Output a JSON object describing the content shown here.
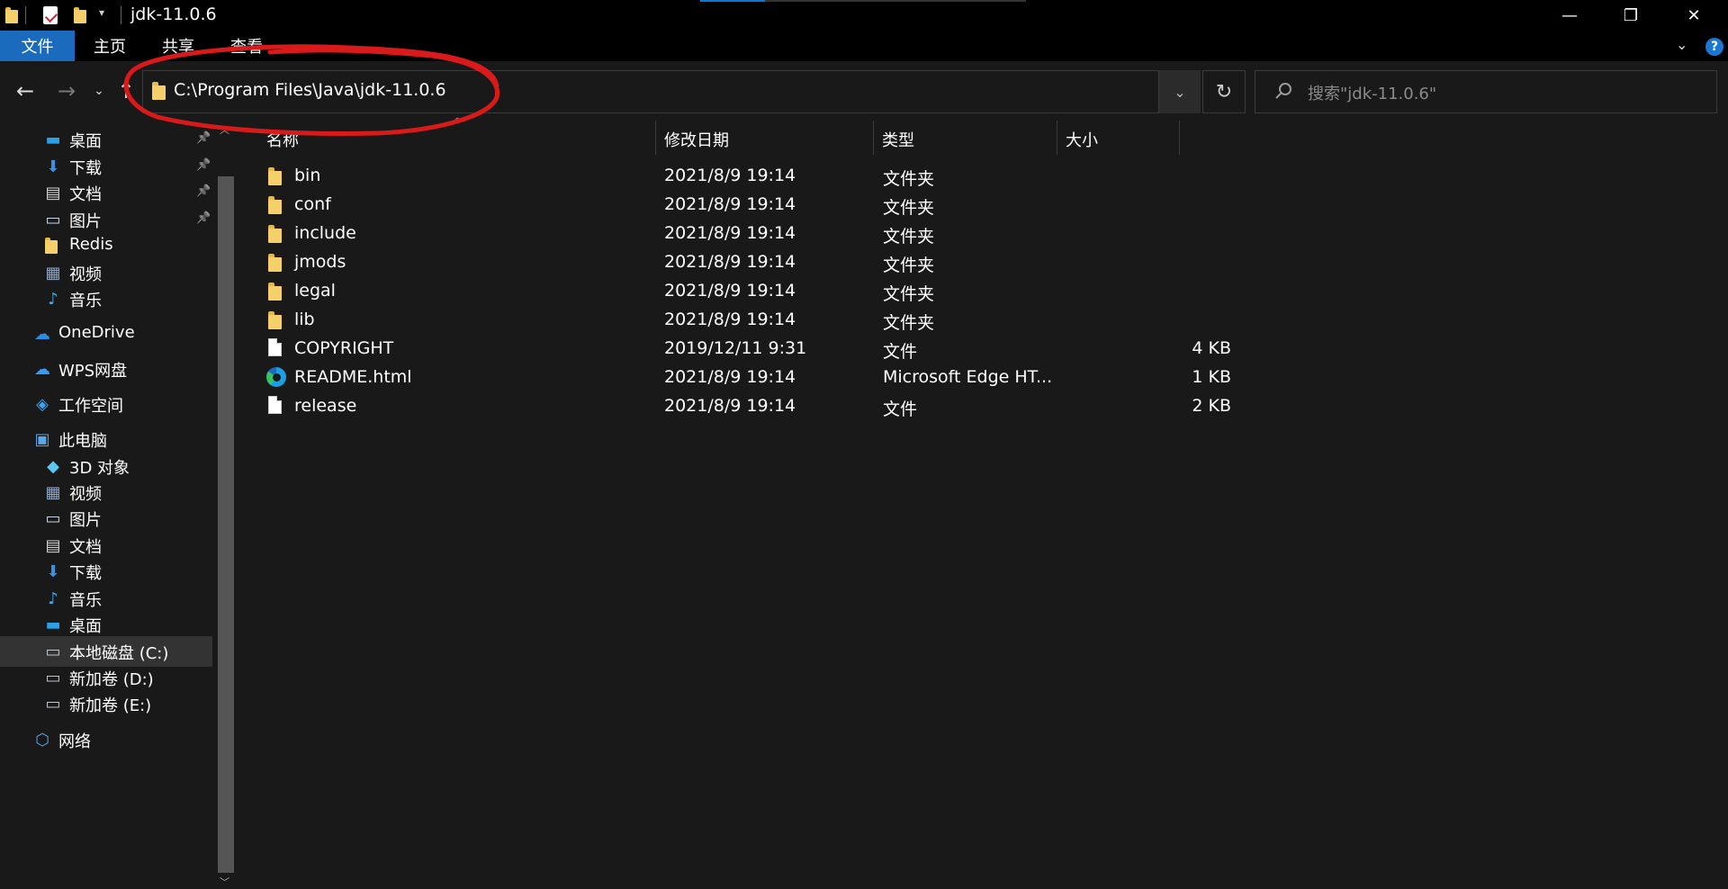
{
  "window": {
    "title": "jdk-11.0.6",
    "controls": {
      "minimize": "—",
      "maximize": "❐",
      "close": "✕"
    }
  },
  "ribbon": {
    "tabs": [
      "文件",
      "主页",
      "共享",
      "查看"
    ],
    "help": "?"
  },
  "address": {
    "path": "C:\\Program Files\\Java\\jdk-11.0.6"
  },
  "search": {
    "placeholder": "搜索\"jdk-11.0.6\""
  },
  "sidebar": {
    "items": [
      {
        "label": "桌面",
        "icon": "desktop-icon",
        "pinned": true
      },
      {
        "label": "下载",
        "icon": "download-icon",
        "pinned": true
      },
      {
        "label": "文档",
        "icon": "document-icon",
        "pinned": true
      },
      {
        "label": "图片",
        "icon": "picture-icon",
        "pinned": true
      },
      {
        "label": "Redis",
        "icon": "folder-icon",
        "pinned": false
      },
      {
        "label": "视频",
        "icon": "video-icon",
        "pinned": false
      },
      {
        "label": "音乐",
        "icon": "music-icon",
        "pinned": false
      },
      {
        "label": "OneDrive",
        "icon": "onedrive-icon",
        "pinned": false
      },
      {
        "label": "WPS网盘",
        "icon": "wps-cloud-icon",
        "pinned": false
      },
      {
        "label": "工作空间",
        "icon": "workspace-icon",
        "pinned": false
      },
      {
        "label": "此电脑",
        "icon": "this-pc-icon",
        "pinned": false
      },
      {
        "label": "3D 对象",
        "icon": "3d-objects-icon",
        "pinned": false
      },
      {
        "label": "视频",
        "icon": "video-icon",
        "pinned": false
      },
      {
        "label": "图片",
        "icon": "picture-icon",
        "pinned": false
      },
      {
        "label": "文档",
        "icon": "document-icon",
        "pinned": false
      },
      {
        "label": "下载",
        "icon": "download-icon",
        "pinned": false
      },
      {
        "label": "音乐",
        "icon": "music-icon",
        "pinned": false
      },
      {
        "label": "桌面",
        "icon": "desktop-icon",
        "pinned": false
      },
      {
        "label": "本地磁盘 (C:)",
        "icon": "drive-icon",
        "pinned": false,
        "selected": true
      },
      {
        "label": "新加卷 (D:)",
        "icon": "drive-icon",
        "pinned": false
      },
      {
        "label": "新加卷 (E:)",
        "icon": "drive-icon",
        "pinned": false
      },
      {
        "label": "网络",
        "icon": "network-icon",
        "pinned": false
      }
    ]
  },
  "columns": {
    "name": "名称",
    "date": "修改日期",
    "type": "类型",
    "size": "大小"
  },
  "files": [
    {
      "name": "bin",
      "date": "2021/8/9 19:14",
      "type": "文件夹",
      "size": "",
      "icon": "folder-icon"
    },
    {
      "name": "conf",
      "date": "2021/8/9 19:14",
      "type": "文件夹",
      "size": "",
      "icon": "folder-icon"
    },
    {
      "name": "include",
      "date": "2021/8/9 19:14",
      "type": "文件夹",
      "size": "",
      "icon": "folder-icon"
    },
    {
      "name": "jmods",
      "date": "2021/8/9 19:14",
      "type": "文件夹",
      "size": "",
      "icon": "folder-icon"
    },
    {
      "name": "legal",
      "date": "2021/8/9 19:14",
      "type": "文件夹",
      "size": "",
      "icon": "folder-icon"
    },
    {
      "name": "lib",
      "date": "2021/8/9 19:14",
      "type": "文件夹",
      "size": "",
      "icon": "folder-icon"
    },
    {
      "name": "COPYRIGHT",
      "date": "2019/12/11 9:31",
      "type": "文件",
      "size": "4 KB",
      "icon": "file-icon"
    },
    {
      "name": "README.html",
      "date": "2021/8/9 19:14",
      "type": "Microsoft Edge HT...",
      "size": "1 KB",
      "icon": "edge-icon"
    },
    {
      "name": "release",
      "date": "2021/8/9 19:14",
      "type": "文件",
      "size": "2 KB",
      "icon": "file-icon"
    }
  ],
  "colors": {
    "background": "#191919",
    "file_tab": "#1a6bbd",
    "annotation": "#d81a1a",
    "folder": "#f4cf6a"
  }
}
